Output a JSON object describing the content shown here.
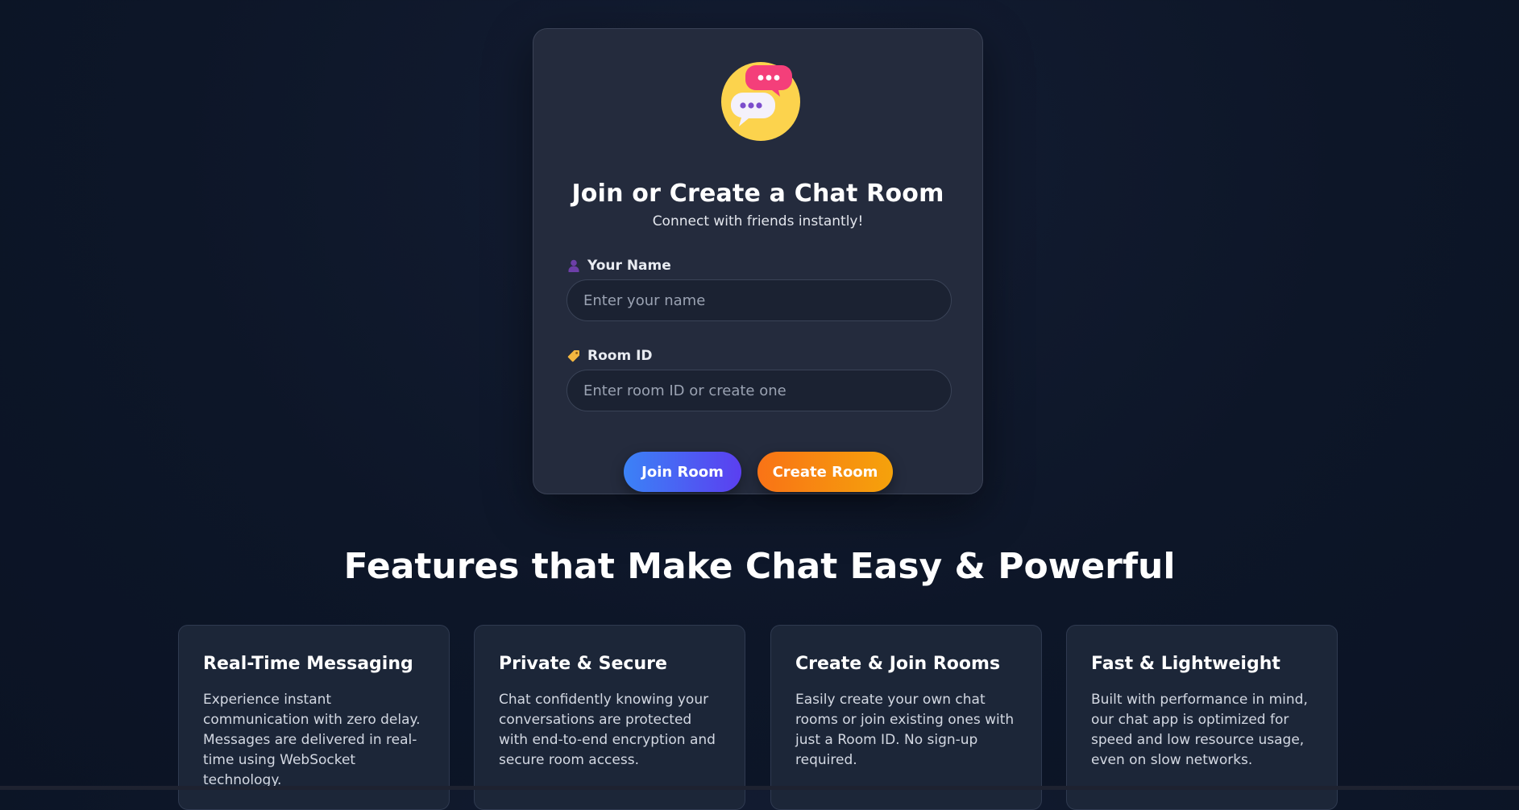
{
  "card": {
    "logo_icon": "chat-bubbles-icon",
    "title": "Join or Create a Chat Room",
    "subtitle": "Connect with friends instantly!",
    "name_field": {
      "icon": "user-icon",
      "label": "Your Name",
      "placeholder": "Enter your name",
      "value": ""
    },
    "room_field": {
      "icon": "tag-icon",
      "label": "Room ID",
      "placeholder": "Enter room ID or create one",
      "value": ""
    },
    "join_button": "Join Room",
    "create_button": "Create Room"
  },
  "features": {
    "title": "Features that Make Chat Easy & Powerful",
    "items": [
      {
        "title": "Real-Time Messaging",
        "description": "Experience instant communication with zero delay. Messages are delivered in real-time using WebSocket technology."
      },
      {
        "title": "Private & Secure",
        "description": "Chat confidently knowing your conversations are protected with end-to-end encryption and secure room access."
      },
      {
        "title": "Create & Join Rooms",
        "description": "Easily create your own chat rooms or join existing ones with just a Room ID. No sign-up required."
      },
      {
        "title": "Fast & Lightweight",
        "description": "Built with performance in mind, our chat app is optimized for speed and low resource usage, even on slow networks."
      }
    ]
  },
  "colors": {
    "background": "#0d1628",
    "card": "#242b3d",
    "join_gradient": [
      "#3b82f6",
      "#5b3ff0"
    ],
    "create_gradient": [
      "#f97316",
      "#f5a20b"
    ],
    "logo_circle": "#fcd34d",
    "bubble_pink": "#f43f7a"
  }
}
